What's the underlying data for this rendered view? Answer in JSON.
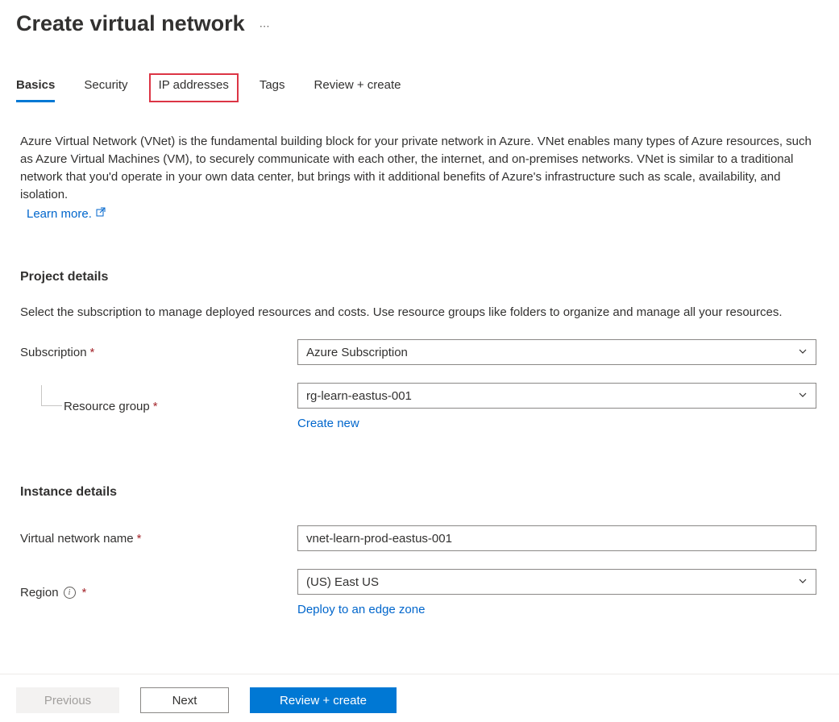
{
  "page": {
    "title": "Create virtual network"
  },
  "tabs": {
    "basics": "Basics",
    "security": "Security",
    "ip_addresses": "IP addresses",
    "tags": "Tags",
    "review_create": "Review + create"
  },
  "intro": {
    "description": "Azure Virtual Network (VNet) is the fundamental building block for your private network in Azure. VNet enables many types of Azure resources, such as Azure Virtual Machines (VM), to securely communicate with each other, the internet, and on-premises networks. VNet is similar to a traditional network that you'd operate in your own data center, but brings with it additional benefits of Azure's infrastructure such as scale, availability, and isolation.",
    "learn_more": "Learn more."
  },
  "project_details": {
    "heading": "Project details",
    "description": "Select the subscription to manage deployed resources and costs. Use resource groups like folders to organize and manage all your resources.",
    "subscription_label": "Subscription",
    "subscription_value": "Azure Subscription",
    "resource_group_label": "Resource group",
    "resource_group_value": "rg-learn-eastus-001",
    "create_new": "Create new"
  },
  "instance_details": {
    "heading": "Instance details",
    "vnet_name_label": "Virtual network name",
    "vnet_name_value": "vnet-learn-prod-eastus-001",
    "region_label": "Region",
    "region_value": "(US) East US",
    "edge_zone": "Deploy to an edge zone"
  },
  "footer": {
    "previous": "Previous",
    "next": "Next",
    "review_create": "Review + create"
  }
}
